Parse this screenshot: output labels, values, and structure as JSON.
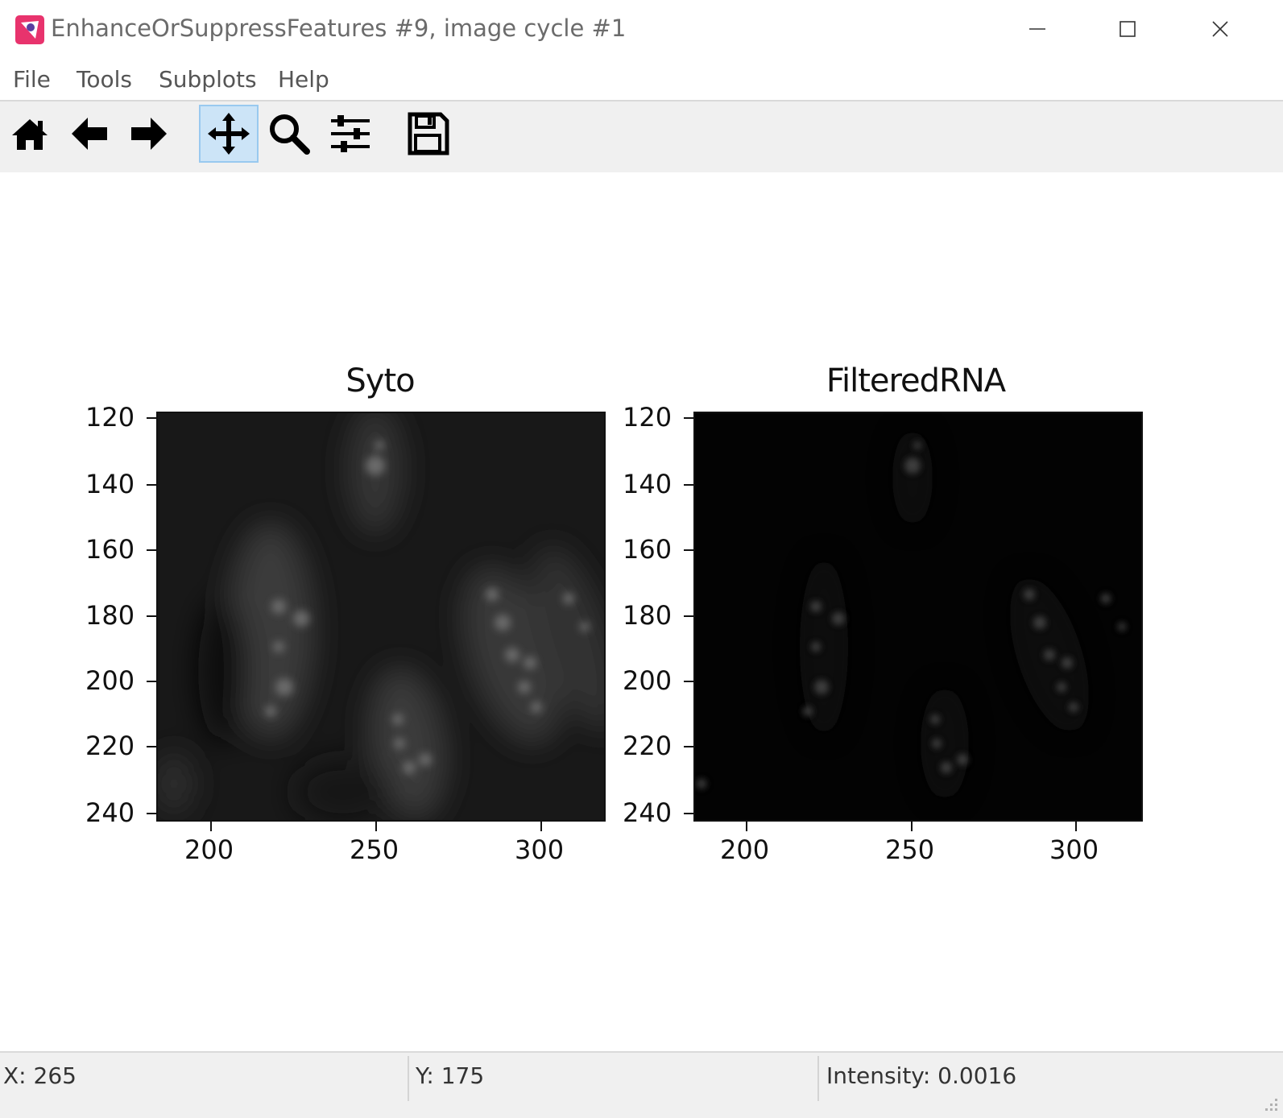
{
  "window": {
    "title": "EnhanceOrSuppressFeatures #9, image cycle #1",
    "accent_color": "#e8336d"
  },
  "menu": {
    "items": [
      {
        "label": "File"
      },
      {
        "label": "Tools"
      },
      {
        "label": "Subplots"
      },
      {
        "label": "Help"
      }
    ]
  },
  "toolbar": {
    "buttons": [
      {
        "icon": "home-icon",
        "active": false
      },
      {
        "icon": "back-arrow-icon",
        "active": false
      },
      {
        "icon": "forward-arrow-icon",
        "active": false
      },
      {
        "icon": "pan-move-icon",
        "active": true
      },
      {
        "icon": "zoom-magnifier-icon",
        "active": false
      },
      {
        "icon": "configure-subplots-icon",
        "active": false
      },
      {
        "icon": "save-floppy-icon",
        "active": false
      }
    ]
  },
  "plots": [
    {
      "title": "Syto",
      "yticks": [
        "120",
        "140",
        "160",
        "180",
        "200",
        "220",
        "240"
      ],
      "xticks": [
        "200",
        "250",
        "300"
      ]
    },
    {
      "title": "FilteredRNA",
      "yticks": [
        "120",
        "140",
        "160",
        "180",
        "200",
        "220",
        "240"
      ],
      "xticks": [
        "200",
        "250",
        "300"
      ]
    }
  ],
  "status": {
    "x": "X: 265",
    "y": "Y: 175",
    "intensity": "Intensity: 0.0016"
  }
}
